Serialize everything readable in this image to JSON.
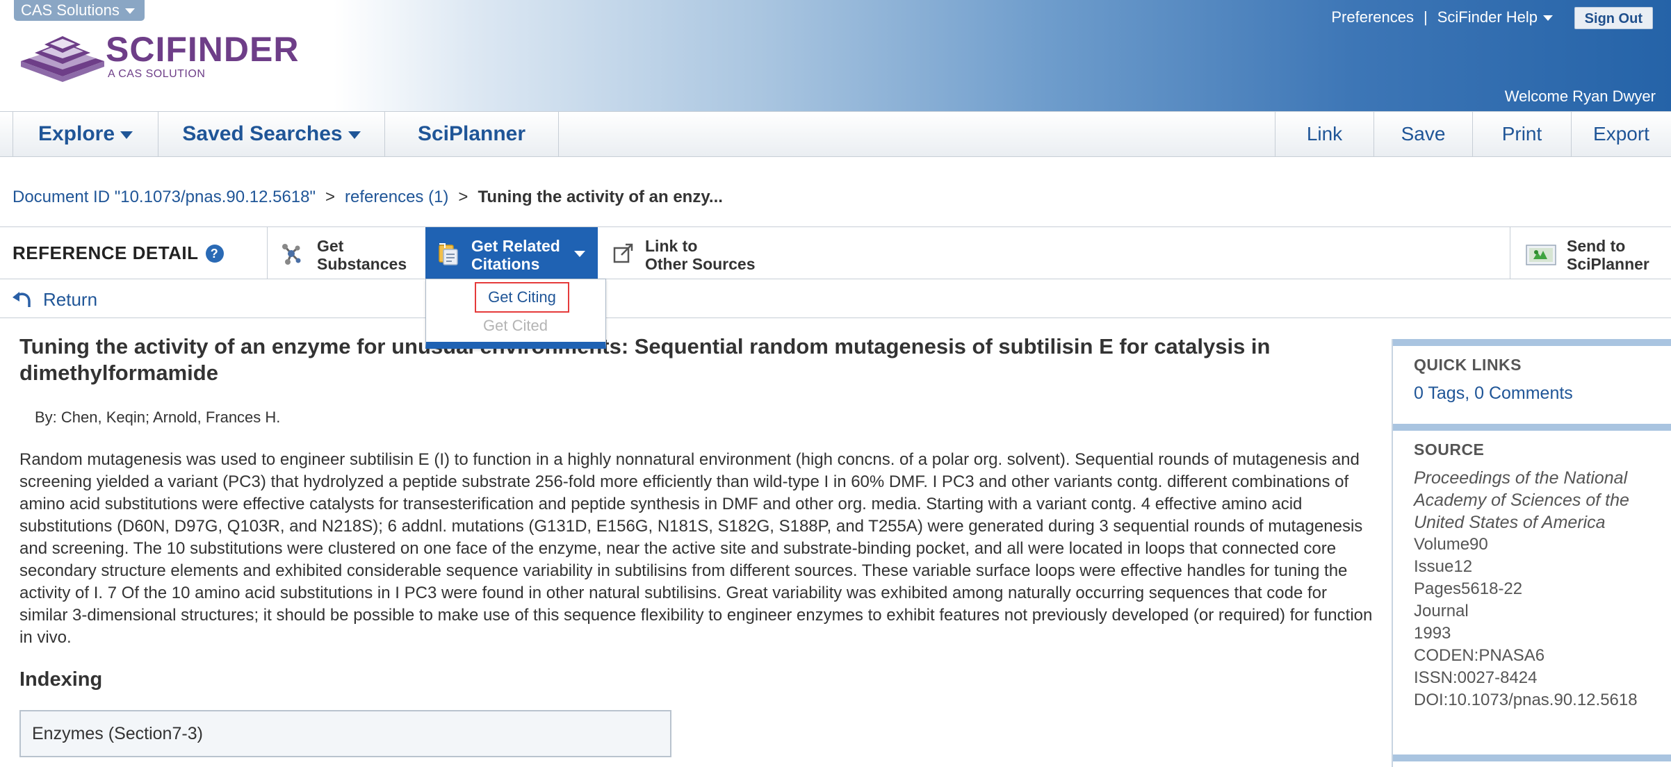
{
  "header": {
    "cas_solutions_label": "CAS Solutions",
    "logo_text": "SciFinder",
    "logo_sub": "A CAS SOLUTION",
    "preferences_label": "Preferences",
    "separator": "|",
    "help_label": "SciFinder Help",
    "sign_out_label": "Sign Out",
    "welcome_text": "Welcome Ryan Dwyer"
  },
  "nav": {
    "explore_label": "Explore",
    "saved_searches_label": "Saved Searches",
    "sciplanner_label": "SciPlanner",
    "link_label": "Link",
    "save_label": "Save",
    "print_label": "Print",
    "export_label": "Export"
  },
  "breadcrumb": {
    "document_id": "Document ID \"10.1073/pnas.90.12.5618\"",
    "references": "references (1)",
    "current": "Tuning the activity of an enzy...",
    "sep": ">"
  },
  "toolbar": {
    "title": "REFERENCE DETAIL",
    "help_glyph": "?",
    "get_substances_line1": "Get",
    "get_substances_line2": "Substances",
    "get_related_line1": "Get Related",
    "get_related_line2": "Citations",
    "link_other_line1": "Link to",
    "link_other_line2": "Other Sources",
    "send_line1": "Send to",
    "send_line2": "SciPlanner"
  },
  "dropdown": {
    "get_citing": "Get Citing",
    "get_cited": "Get Cited"
  },
  "return_label": "Return",
  "reference": {
    "title": "Tuning the activity of an enzyme for unusual environments: Sequential random mutagenesis of subtilisin E for catalysis in dimethylformamide",
    "authors": "By: Chen, Keqin; Arnold, Frances H.",
    "abstract": "Random mutagenesis was used to engineer subtilisin E (I) to function in a highly nonnatural environment (high concns. of a polar org. solvent).  Sequential rounds of mutagenesis and screening yielded a variant (PC3) that hydrolyzed a peptide substrate 256-fold more efficiently than wild-type I in 60% DMF.  I PC3 and other variants contg. different combinations of amino acid substitutions were effective catalysts for transesterification and peptide synthesis in DMF and other org. media.  Starting with a variant contg. 4 effective amino acid substitutions (D60N, D97G, Q103R, and N218S); 6 addnl. mutations (G131D, E156G, N181S, S182G, S188P, and T255A) were generated during 3 sequential rounds of mutagenesis and screening.  The 10 substitutions were clustered on one face of the enzyme, near the active site and substrate-binding pocket, and all were located in loops that connected core secondary structure elements and exhibited considerable sequence variability in subtilisins from different sources.  These variable surface loops were effective handles for tuning the activity of I.  7 Of the 10 amino acid substitutions in I PC3 were found in other natural subtilisins.  Great variability was exhibited among naturally occurring sequences that code for similar 3-dimensional structures; it should be possible to make use of this sequence flexibility to engineer enzymes to exhibit features not previously developed (or required) for function in vivo.",
    "indexing_heading": "Indexing",
    "indexing_item": "Enzymes (Section7-3)"
  },
  "sidebar": {
    "quick_links_heading": "QUICK LINKS",
    "tags_comments": "0 Tags, 0 Comments",
    "source_heading": "SOURCE",
    "journal": "Proceedings of the National Academy of Sciences of the United States of America",
    "volume": "Volume90",
    "issue": "Issue12",
    "pages": "Pages5618-22",
    "doc_type": "Journal",
    "year": "1993",
    "coden": "CODEN:PNASA6",
    "issn": "ISSN:0027-8424",
    "doi": "DOI:10.1073/pnas.90.12.5618"
  },
  "colors": {
    "accent_blue": "#1f62b3",
    "link_blue": "#1f5597",
    "logo_purple": "#6e3e88",
    "highlight_red": "#e53a3a"
  }
}
